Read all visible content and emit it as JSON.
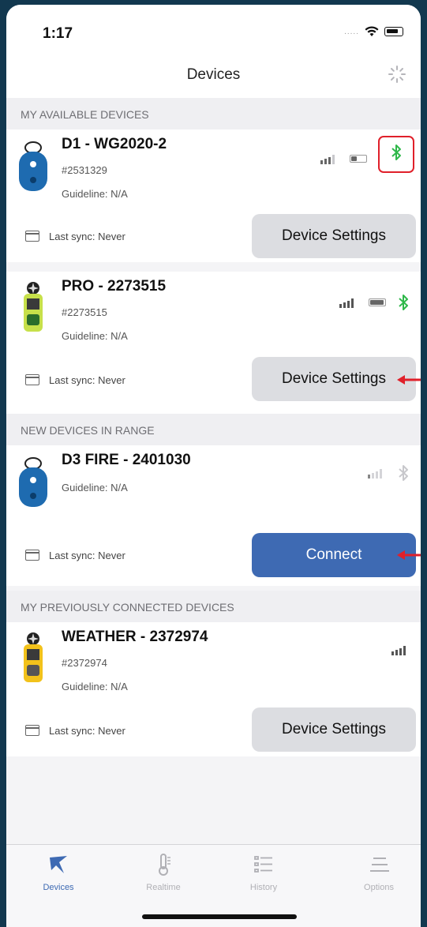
{
  "status_bar": {
    "time": "1:17",
    "signal": "....."
  },
  "header": {
    "title": "Devices"
  },
  "sections": {
    "available": "MY AVAILABLE DEVICES",
    "new_range": "NEW DEVICES IN RANGE",
    "previous": "MY PREVIOUSLY CONNECTED DEVICES"
  },
  "devices": [
    {
      "name": "D1 - WG2020-2",
      "serial": "#2531329",
      "guideline": "Guideline: N/A",
      "sync": "Last sync: Never",
      "action": "Device Settings",
      "battery_level": 0.35,
      "bluetooth_color": "#2fb84a"
    },
    {
      "name": "PRO - 2273515",
      "serial": "#2273515",
      "guideline": "Guideline: N/A",
      "sync": "Last sync: Never",
      "action": "Device Settings",
      "battery_level": 0.9,
      "bluetooth_color": "#2fb84a"
    },
    {
      "name": "D3 FIRE - 2401030",
      "guideline": "Guideline: N/A",
      "sync": "Last sync: Never",
      "action": "Connect",
      "bluetooth_color": "#c8c8cc"
    },
    {
      "name": "WEATHER - 2372974",
      "serial": "#2372974",
      "guideline": "Guideline: N/A",
      "sync": "Last sync: Never",
      "action": "Device Settings"
    }
  ],
  "tabs": [
    {
      "label": "Devices",
      "icon": "devices-swift-icon",
      "active": true
    },
    {
      "label": "Realtime",
      "icon": "thermometer-icon",
      "active": false
    },
    {
      "label": "History",
      "icon": "list-icon",
      "active": false
    },
    {
      "label": "Options",
      "icon": "options-icon",
      "active": false
    }
  ],
  "colors": {
    "accent": "#3e6ab3",
    "bluetooth_active": "#2fb84a",
    "highlight": "#e0202a"
  }
}
